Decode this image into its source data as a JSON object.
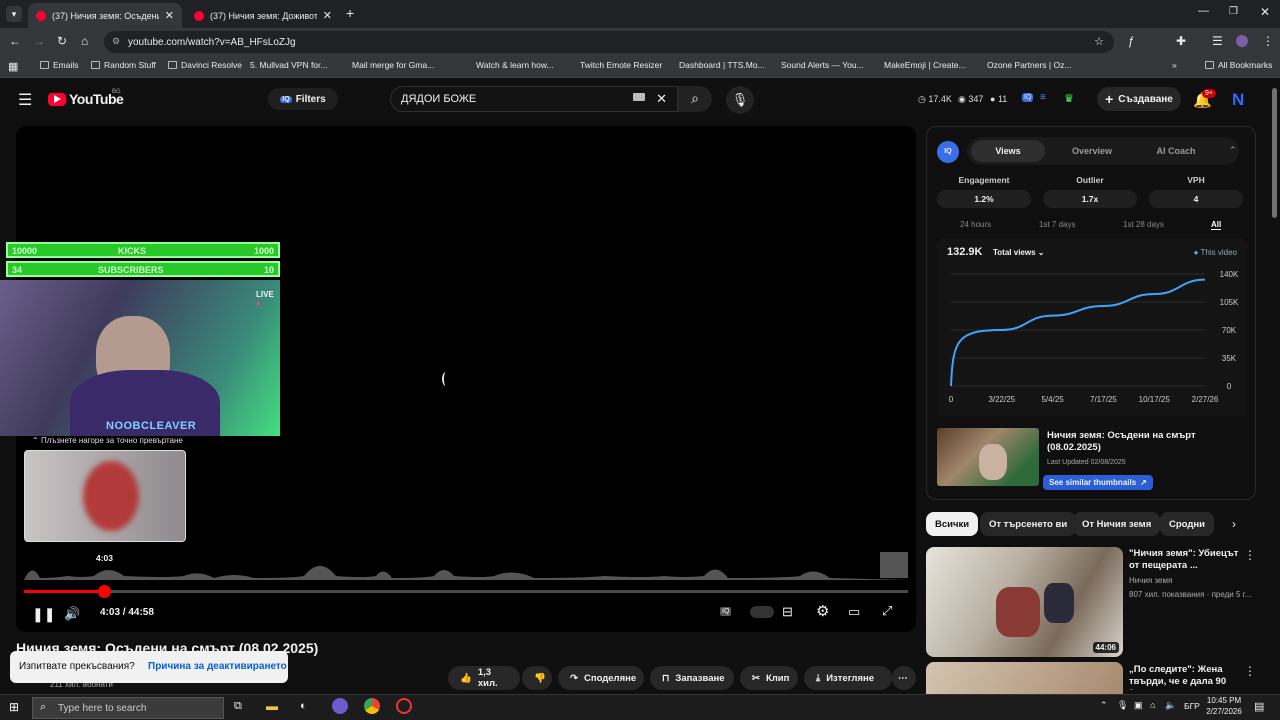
{
  "browser": {
    "tabs": [
      {
        "title": "(37) Ничия земя: Осъдени на с"
      },
      {
        "title": "(37) Ничия земя: Доживотна з"
      }
    ],
    "url": "youtube.com/watch?v=AB_HFsLoZJg",
    "bookmarks": [
      "Emails",
      "Random Stuff",
      "Davinci Resolve",
      "5. Mullvad VPN for...",
      "Mail merge for Gma...",
      "Watch & learn how...",
      "Twitch Emote Resizer",
      "Dashboard | TTS.Mo...",
      "Sound Alerts — You...",
      "MakeEmoji | Create...",
      "Ozone Partners | Oz..."
    ],
    "all_bookmarks": "All Bookmarks"
  },
  "youtube": {
    "logo": "YouTube",
    "region": "BG",
    "filters": "Filters",
    "search_value": "ДЯДОИ БОЖЕ",
    "stat_1": "17.4K",
    "stat_2": "347",
    "stat_3": "11",
    "create": "Създаване",
    "notif_badge": "9+",
    "avatar": "N"
  },
  "overlay": {
    "kicks_left": "10000",
    "kicks_label": "KICKS",
    "kicks_right": "1000",
    "subs_left": "34",
    "subs_label": "SUBSCRIBERS",
    "subs_right": "10",
    "live": "LIVE",
    "streamer": "NOOBCLEAVER",
    "seek_hint": "Плъзнете нагоре за точно превъртане"
  },
  "player": {
    "hover_time": "4:03",
    "time": "4:03 / 44:58",
    "progress": 0.09
  },
  "vidiq": {
    "tabs": [
      "Views",
      "Overview",
      "AI Coach"
    ],
    "engagement_label": "Engagement",
    "engagement": "1.2%",
    "outlier_label": "Outlier",
    "outlier": "1.7x",
    "vph_label": "VPH",
    "vph": "4",
    "ranges": [
      "24 hours",
      "1st 7 days",
      "1st 28 days",
      "All"
    ],
    "total": "132.9K",
    "metric": "Total views",
    "legend": "This video",
    "thumb_title": "Ничия земя: Осъдени на смърт (08.02.2025)",
    "updated": "Last Updated 02/08/2025",
    "similar": "See similar thumbnails"
  },
  "chart_data": {
    "type": "line",
    "x": [
      "0",
      "3/22/25",
      "5/4/25",
      "7/17/25",
      "10/17/25",
      "2/27/26"
    ],
    "yticks": [
      "0",
      "35K",
      "70K",
      "105K",
      "140K"
    ],
    "ylim": [
      0,
      140000
    ],
    "series": [
      {
        "name": "This video",
        "values": [
          0,
          70000,
          88000,
          100000,
          115000,
          132900
        ]
      }
    ],
    "legend_position": "top-right",
    "grid": true
  },
  "chips": [
    "Всички",
    "От търсенето ви",
    "От Ничия земя",
    "Сродни"
  ],
  "related": [
    {
      "title": "\"Ничия земя\": Убиецът от пещерата ...",
      "channel": "Ничия земя",
      "meta": "807 хил. показвания · преди 5 г...",
      "duration": "44:06"
    },
    {
      "title": "„По следите\": Жена твърди, че е дала 90 0...",
      "channel": "",
      "meta": "",
      "duration": ""
    }
  ],
  "below": {
    "title": "Ничия земя: Осъдени на смърт (08.02.2025)",
    "subs": "211 хил. абонати",
    "likes": "1,3 хил.",
    "share": "Споделяне",
    "save": "Запазване",
    "clip": "Клип",
    "download": "Изтегляне",
    "toast_q": "Изпитвате прекъсвания?",
    "toast_link": "Причина за деактивирането"
  },
  "taskbar": {
    "search": "Type here to search",
    "lang": "БГР",
    "time": "10:45 PM",
    "date": "2/27/2026"
  }
}
